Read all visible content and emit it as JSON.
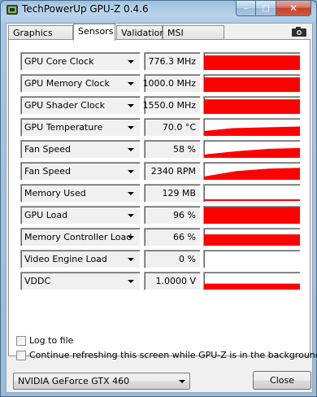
{
  "window": {
    "title": "TechPowerUp GPU-Z 0.4.6",
    "close_glyph": "✕",
    "maximize_glyph": "□",
    "minimize_glyph": "‒"
  },
  "tabs": [
    {
      "label": "Graphics Card",
      "active": false
    },
    {
      "label": "Sensors",
      "active": true
    },
    {
      "label": "Validation",
      "active": false
    },
    {
      "label": "MSI Giveaway",
      "active": false
    }
  ],
  "sensors": [
    {
      "label": "GPU Core Clock",
      "value": "776.3 MHz",
      "level": 0.85
    },
    {
      "label": "GPU Memory Clock",
      "value": "1000.0 MHz",
      "level": 0.85
    },
    {
      "label": "GPU Shader Clock",
      "value": "1550.0 MHz",
      "level": 0.85
    },
    {
      "label": "GPU Temperature",
      "value": "70.0 °C",
      "level": 0.55
    },
    {
      "label": "Fan Speed",
      "value": "58 %",
      "level": 0.58
    },
    {
      "label": "Fan Speed",
      "value": "2340 RPM",
      "level": 0.7
    },
    {
      "label": "Memory Used",
      "value": "129 MB",
      "level": 0.08
    },
    {
      "label": "GPU Load",
      "value": "96 %",
      "level": 0.96
    },
    {
      "label": "Memory Controller Load",
      "value": "66 %",
      "level": 0.66
    },
    {
      "label": "Video Engine Load",
      "value": "0 %",
      "level": 0
    },
    {
      "label": "VDDC",
      "value": "1.0000 V",
      "level": 0.35
    }
  ],
  "options": {
    "log_to_file": {
      "label": "Log to file",
      "checked": false
    },
    "continue_refresh": {
      "label": "Continue refreshing this screen while GPU-Z is in the background",
      "checked": false
    }
  },
  "gpu_selector": {
    "value": "NVIDIA GeForce GTX 460"
  },
  "buttons": {
    "close_label": "Close"
  },
  "colors": {
    "graph": "#ff0000"
  },
  "icons": [
    "gpu-z-app-icon",
    "camera-icon",
    "dropdown-arrow-icon"
  ]
}
